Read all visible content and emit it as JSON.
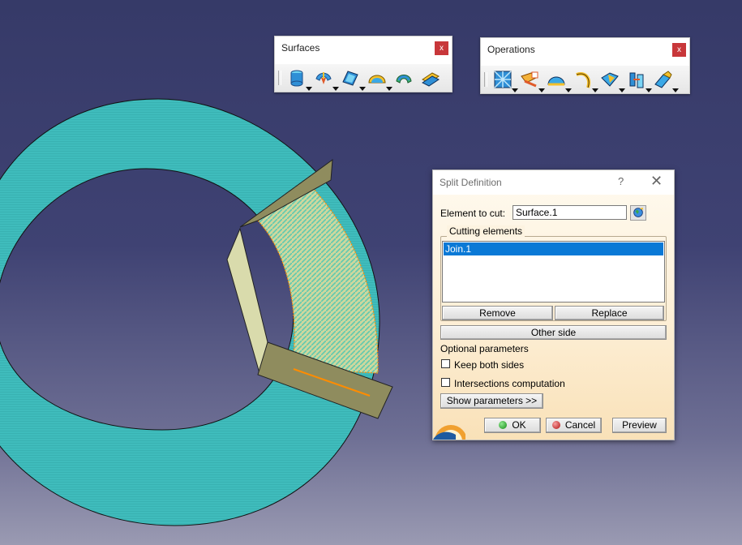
{
  "toolbars": {
    "surfaces": {
      "title": "Surfaces",
      "close": "x",
      "icons": [
        "extrude-cylinder-icon",
        "sweep-surface-icon",
        "fill-surface-icon",
        "blend-surface-icon",
        "offset-surface-icon",
        "multi-section-surface-icon"
      ]
    },
    "operations": {
      "title": "Operations",
      "close": "x",
      "icons": [
        "join-healing-icon",
        "split-trim-icon",
        "boundary-icon",
        "extract-icon",
        "fillet-icon",
        "transformations-icon",
        "extrapolate-icon"
      ]
    }
  },
  "dialog": {
    "title": "Split Definition",
    "help": "?",
    "close": "✕",
    "element_to_cut_label": "Element to cut:",
    "element_to_cut_value": "Surface.1",
    "cutting_elements_label": "Cutting elements",
    "cutting_elements": [
      "Join.1"
    ],
    "remove_label": "Remove",
    "replace_label": "Replace",
    "other_side_label": "Other side",
    "optional_parameters_label": "Optional parameters",
    "keep_both_sides_label": "Keep both sides",
    "intersections_label": "Intersections computation",
    "show_parameters_label": "Show parameters >>",
    "ok_label": "OK",
    "cancel_label": "Cancel",
    "preview_label": "Preview"
  },
  "colors": {
    "background_top": "#363a68",
    "surface_ring": "#3bbcbc",
    "split_region": "#c6d49e",
    "cutting_plane": "#d7d9a8",
    "highlight_edge": "#ff8c00",
    "selection": "#0a79d6"
  }
}
